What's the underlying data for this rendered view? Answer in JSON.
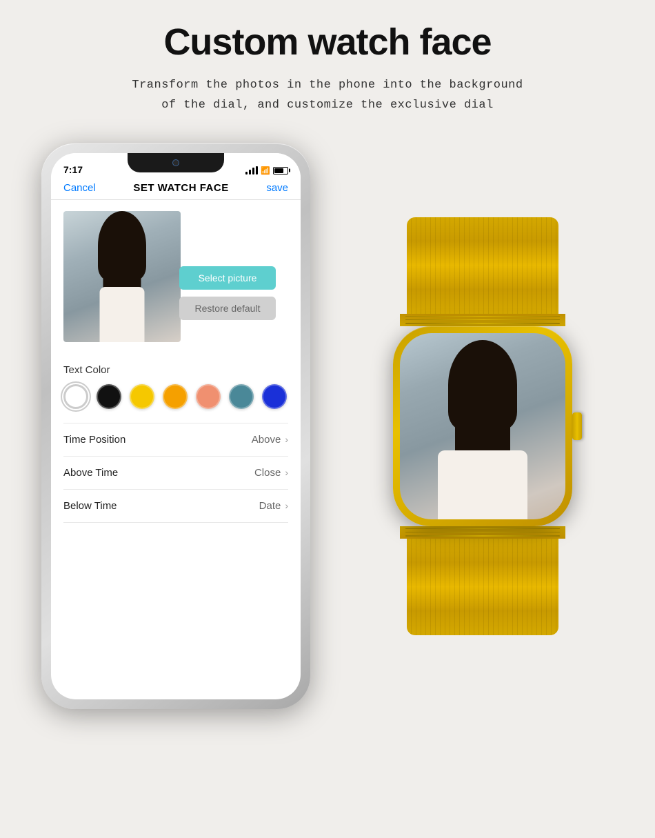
{
  "page": {
    "title": "Custom watch face",
    "subtitle_line1": "Transform the photos in the phone into the background",
    "subtitle_line2": "of the dial, and customize the exclusive dial"
  },
  "phone": {
    "status_time": "7:17",
    "header": {
      "cancel": "Cancel",
      "title": "SET WATCH FACE",
      "save": "save"
    },
    "buttons": {
      "select": "Select picture",
      "restore": "Restore default"
    },
    "text_color_label": "Text Color",
    "colors": [
      {
        "name": "white",
        "hex": "#ffffff",
        "selected": true
      },
      {
        "name": "black",
        "hex": "#111111"
      },
      {
        "name": "yellow",
        "hex": "#f5c800"
      },
      {
        "name": "orange",
        "hex": "#f5a000"
      },
      {
        "name": "salmon",
        "hex": "#f09070"
      },
      {
        "name": "teal",
        "hex": "#4a8898"
      },
      {
        "name": "blue",
        "hex": "#1a30d8"
      }
    ],
    "settings": [
      {
        "label": "Time Position",
        "value": "Above"
      },
      {
        "label": "Above Time",
        "value": "Close"
      },
      {
        "label": "Below Time",
        "value": "Date"
      }
    ]
  },
  "watch": {
    "band_color": "#d4a800",
    "body_color": "#d4aa00"
  }
}
